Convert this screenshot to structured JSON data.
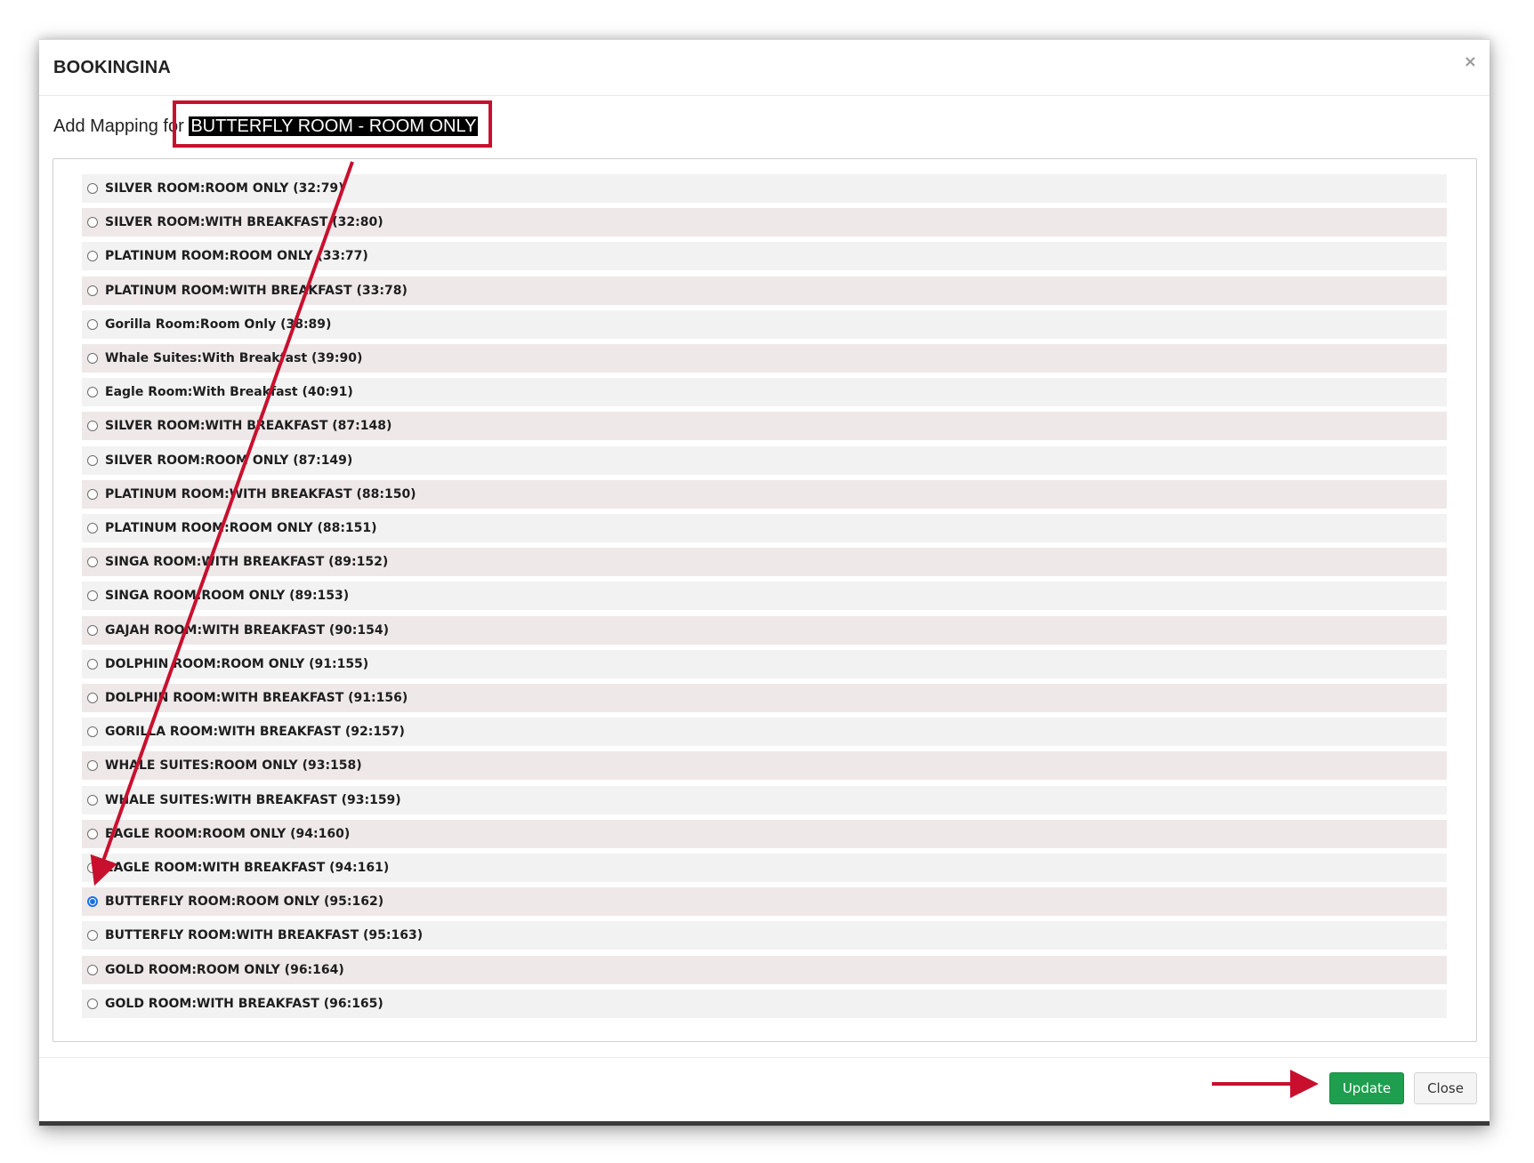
{
  "modal": {
    "title": "BOOKINGINA",
    "close_icon": "×"
  },
  "heading": {
    "prefix": "Add Mapping for",
    "room_name": "BUTTERFLY ROOM - ROOM ONLY"
  },
  "options": [
    {
      "label": "SILVER ROOM:ROOM ONLY (32:79)",
      "checked": false
    },
    {
      "label": "SILVER ROOM:WITH BREAKFAST (32:80)",
      "checked": false
    },
    {
      "label": "PLATINUM ROOM:ROOM ONLY (33:77)",
      "checked": false
    },
    {
      "label": "PLATINUM ROOM:WITH BREAKFAST (33:78)",
      "checked": false
    },
    {
      "label": "Gorilla Room:Room Only (38:89)",
      "checked": false
    },
    {
      "label": "Whale Suites:With Breakfast (39:90)",
      "checked": false
    },
    {
      "label": "Eagle Room:With Breakfast (40:91)",
      "checked": false
    },
    {
      "label": "SILVER ROOM:WITH BREAKFAST (87:148)",
      "checked": false
    },
    {
      "label": "SILVER ROOM:ROOM ONLY (87:149)",
      "checked": false
    },
    {
      "label": "PLATINUM ROOM:WITH BREAKFAST (88:150)",
      "checked": false
    },
    {
      "label": "PLATINUM ROOM:ROOM ONLY (88:151)",
      "checked": false
    },
    {
      "label": "SINGA ROOM:WITH BREAKFAST (89:152)",
      "checked": false
    },
    {
      "label": "SINGA ROOM:ROOM ONLY (89:153)",
      "checked": false
    },
    {
      "label": "GAJAH ROOM:WITH BREAKFAST (90:154)",
      "checked": false
    },
    {
      "label": "DOLPHIN ROOM:ROOM ONLY (91:155)",
      "checked": false
    },
    {
      "label": "DOLPHIN ROOM:WITH BREAKFAST (91:156)",
      "checked": false
    },
    {
      "label": "GORILLA ROOM:WITH BREAKFAST (92:157)",
      "checked": false
    },
    {
      "label": "WHALE SUITES:ROOM ONLY (93:158)",
      "checked": false
    },
    {
      "label": "WHALE SUITES:WITH BREAKFAST (93:159)",
      "checked": false
    },
    {
      "label": "EAGLE ROOM:ROOM ONLY (94:160)",
      "checked": false
    },
    {
      "label": "EAGLE ROOM:WITH BREAKFAST (94:161)",
      "checked": false
    },
    {
      "label": "BUTTERFLY ROOM:ROOM ONLY (95:162)",
      "checked": true
    },
    {
      "label": "BUTTERFLY ROOM:WITH BREAKFAST (95:163)",
      "checked": false
    },
    {
      "label": "GOLD ROOM:ROOM ONLY (96:164)",
      "checked": false
    },
    {
      "label": "GOLD ROOM:WITH BREAKFAST (96:165)",
      "checked": false
    }
  ],
  "footer": {
    "update_label": "Update",
    "close_label": "Close"
  },
  "colors": {
    "accent_green": "#1e9e4f",
    "annotation_red": "#c8102e",
    "radio_blue": "#1a6fe8"
  }
}
